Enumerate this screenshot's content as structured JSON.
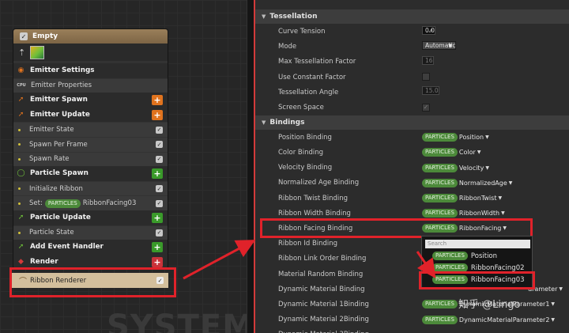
{
  "graph": {
    "watermark": "SYSTEM",
    "emitter": {
      "title": "Empty",
      "rows": [
        {
          "kind": "group",
          "label": "Emitter Settings",
          "icon": "emitter-settings-icon",
          "icon_color": "#e0731e"
        },
        {
          "kind": "item",
          "label": "Emitter Properties",
          "icon": "cpu-icon"
        },
        {
          "kind": "group",
          "label": "Emitter Spawn",
          "icon": "spawn-arrow-icon",
          "icon_color": "#e0731e",
          "add": "orange"
        },
        {
          "kind": "group",
          "label": "Emitter Update",
          "icon": "update-arrow-icon",
          "icon_color": "#e0731e",
          "add": "orange"
        },
        {
          "kind": "item",
          "label": "Emitter State",
          "check": true
        },
        {
          "kind": "item",
          "label": "Spawn Per Frame",
          "check": true
        },
        {
          "kind": "item",
          "label": "Spawn Rate",
          "check": true
        },
        {
          "kind": "group",
          "label": "Particle Spawn",
          "icon": "particle-spawn-icon",
          "icon_color": "#6fbf3a",
          "add": "green"
        },
        {
          "kind": "item",
          "label": "Initialize Ribbon",
          "check": true
        },
        {
          "kind": "set",
          "prefix": "Set:",
          "tag": "PARTICLES",
          "value": "RibbonFacing03",
          "check": true
        },
        {
          "kind": "group",
          "label": "Particle Update",
          "icon": "update-arrow-icon",
          "icon_color": "#6fbf3a",
          "add": "green"
        },
        {
          "kind": "item",
          "label": "Particle State",
          "check": true
        },
        {
          "kind": "group",
          "label": "Add Event Handler",
          "icon": "event-arrow-icon",
          "icon_color": "#6fbf3a",
          "add": "green"
        },
        {
          "kind": "group",
          "label": "Render",
          "icon": "render-icon",
          "icon_color": "#d33a3a",
          "add": "red"
        }
      ],
      "renderer": "Ribbon Renderer"
    }
  },
  "details": {
    "sections": [
      {
        "title": "Tessellation",
        "rows": [
          {
            "label": "Curve Tension",
            "type": "number",
            "value": "0.0"
          },
          {
            "label": "Mode",
            "type": "dropdown",
            "value": "Automatic"
          },
          {
            "label": "Max Tessellation Factor",
            "type": "number_dim",
            "value": "16"
          },
          {
            "label": "Use Constant Factor",
            "type": "checkbox",
            "checked": false
          },
          {
            "label": "Tessellation Angle",
            "type": "number_dim",
            "value": "15.0"
          },
          {
            "label": "Screen Space",
            "type": "checkbox",
            "checked": true
          }
        ]
      },
      {
        "title": "Bindings",
        "rows": [
          {
            "label": "Position Binding",
            "type": "binding",
            "tag": "PARTICLES",
            "value": "Position"
          },
          {
            "label": "Color Binding",
            "type": "binding",
            "tag": "PARTICLES",
            "value": "Color"
          },
          {
            "label": "Velocity Binding",
            "type": "binding",
            "tag": "PARTICLES",
            "value": "Velocity"
          },
          {
            "label": "Normalized Age Binding",
            "type": "binding",
            "tag": "PARTICLES",
            "value": "NormalizedAge"
          },
          {
            "label": "Ribbon Twist Binding",
            "type": "binding",
            "tag": "PARTICLES",
            "value": "RibbonTwist"
          },
          {
            "label": "Ribbon Width Binding",
            "type": "binding",
            "tag": "PARTICLES",
            "value": "RibbonWidth"
          },
          {
            "label": "Ribbon Facing Binding",
            "type": "binding",
            "tag": "PARTICLES",
            "value": "RibbonFacing"
          },
          {
            "label": "Ribbon Id Binding",
            "type": "empty"
          },
          {
            "label": "Ribbon Link Order Binding",
            "type": "empty"
          },
          {
            "label": "Material Random Binding",
            "type": "empty"
          },
          {
            "label": "Dynamic Material Binding",
            "type": "binding_partial",
            "tag": "",
            "value": "arameter"
          },
          {
            "label": "Dynamic Material 1Binding",
            "type": "binding",
            "tag": "PARTICLES",
            "value": "DynamicMaterialParameter1"
          },
          {
            "label": "Dynamic Material 2Binding",
            "type": "binding",
            "tag": "PARTICLES",
            "value": "DynamicMaterialParameter2"
          },
          {
            "label": "Dynamic Material 3Binding",
            "type": "empty"
          }
        ]
      }
    ],
    "popup": {
      "search_placeholder": "Search",
      "items": [
        {
          "tag": "PARTICLES",
          "value": "Position"
        },
        {
          "tag": "PARTICLES",
          "value": "RibbonFacing02"
        },
        {
          "tag": "PARTICLES",
          "value": "RibbonFacing03"
        }
      ]
    }
  },
  "watermark_text": "知乎 @Lingo",
  "colors": {
    "accent_red": "#e0222a",
    "particles_tag": "#4c8a3a",
    "emitter_header": "#9a7f5a"
  }
}
